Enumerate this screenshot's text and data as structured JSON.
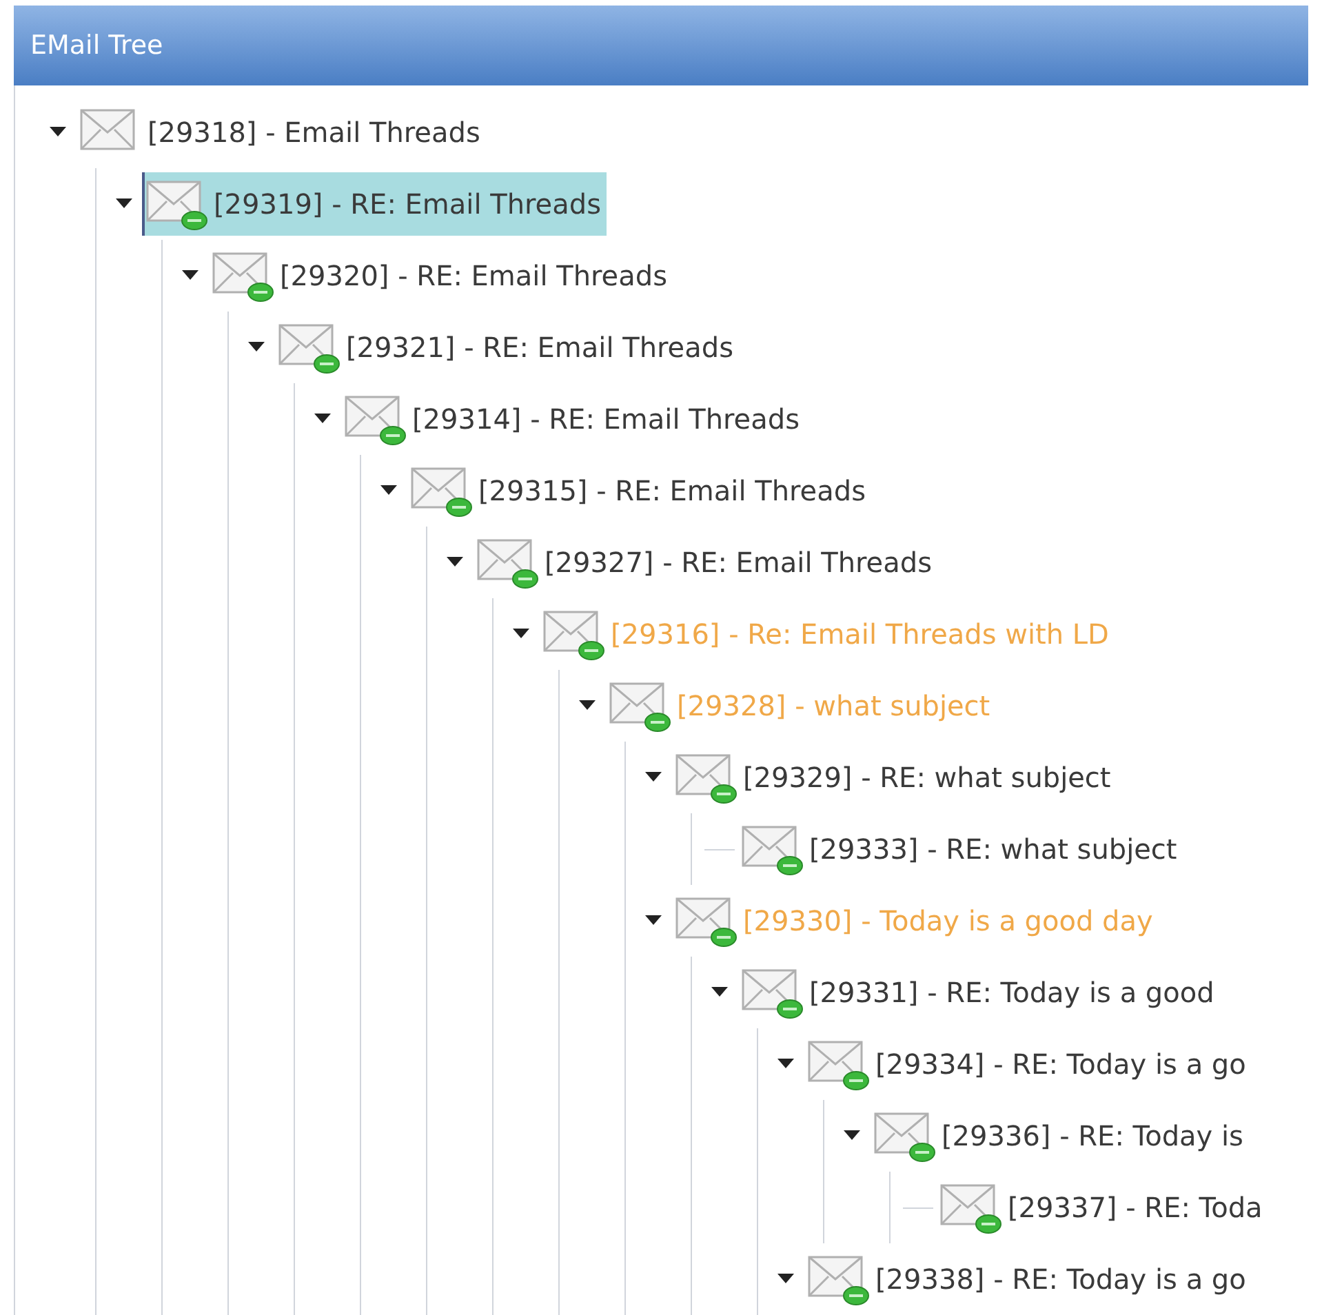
{
  "window": {
    "title": "EMail Tree"
  },
  "tree": [
    {
      "label": "[29318] - Email Threads",
      "kind": "message",
      "expanded": true,
      "selected": false,
      "color": "#3a3a3a",
      "children": [
        {
          "label": "[29319] - RE: Email Threads",
          "kind": "reply",
          "expanded": true,
          "selected": true,
          "color": "#3a3a3a",
          "children": [
            {
              "label": "[29320] - RE: Email Threads",
              "kind": "reply",
              "expanded": true,
              "selected": false,
              "color": "#3a3a3a",
              "children": [
                {
                  "label": "[29321] - RE: Email Threads",
                  "kind": "reply",
                  "expanded": true,
                  "selected": false,
                  "color": "#3a3a3a",
                  "children": [
                    {
                      "label": "[29314] - RE: Email Threads",
                      "kind": "reply",
                      "expanded": true,
                      "selected": false,
                      "color": "#3a3a3a",
                      "children": [
                        {
                          "label": "[29315] - RE: Email Threads",
                          "kind": "reply",
                          "expanded": true,
                          "selected": false,
                          "color": "#3a3a3a",
                          "children": [
                            {
                              "label": "[29327] - RE: Email Threads",
                              "kind": "reply",
                              "expanded": true,
                              "selected": false,
                              "color": "#3a3a3a",
                              "children": [
                                {
                                  "label": "[29316] - Re: Email Threads with LD",
                                  "kind": "reply",
                                  "expanded": true,
                                  "selected": false,
                                  "color": "#f0a848",
                                  "children": [
                                    {
                                      "label": "[29328] - what subject",
                                      "kind": "reply",
                                      "expanded": true,
                                      "selected": false,
                                      "color": "#f0a848",
                                      "children": [
                                        {
                                          "label": "[29329] - RE: what subject",
                                          "kind": "reply",
                                          "expanded": true,
                                          "selected": false,
                                          "color": "#3a3a3a",
                                          "children": [
                                            {
                                              "label": "[29333] - RE: what subject",
                                              "kind": "reply",
                                              "expanded": false,
                                              "selected": false,
                                              "color": "#3a3a3a"
                                            }
                                          ]
                                        },
                                        {
                                          "label": "[29330] - Today is a good day",
                                          "kind": "reply",
                                          "expanded": true,
                                          "selected": false,
                                          "color": "#f0a848",
                                          "children": [
                                            {
                                              "label": "[29331] - RE: Today is a good",
                                              "kind": "reply",
                                              "expanded": true,
                                              "selected": false,
                                              "color": "#3a3a3a",
                                              "children": [
                                                {
                                                  "label": "[29334] - RE: Today is a go",
                                                  "kind": "reply",
                                                  "expanded": true,
                                                  "selected": false,
                                                  "color": "#3a3a3a",
                                                  "children": [
                                                    {
                                                      "label": "[29336] - RE: Today is",
                                                      "kind": "reply",
                                                      "expanded": true,
                                                      "selected": false,
                                                      "color": "#3a3a3a",
                                                      "children": [
                                                        {
                                                          "label": "[29337] - RE: Toda",
                                                          "kind": "reply",
                                                          "expanded": false,
                                                          "selected": false,
                                                          "color": "#3a3a3a"
                                                        }
                                                      ]
                                                    }
                                                  ]
                                                },
                                                {
                                                  "label": "[29338] - RE: Today is a go",
                                                  "kind": "reply",
                                                  "expanded": true,
                                                  "selected": false,
                                                  "color": "#3a3a3a"
                                                }
                                              ]
                                            }
                                          ]
                                        }
                                      ]
                                    }
                                  ]
                                }
                              ]
                            }
                          ]
                        }
                      ]
                    }
                  ]
                }
              ]
            }
          ]
        }
      ]
    }
  ]
}
